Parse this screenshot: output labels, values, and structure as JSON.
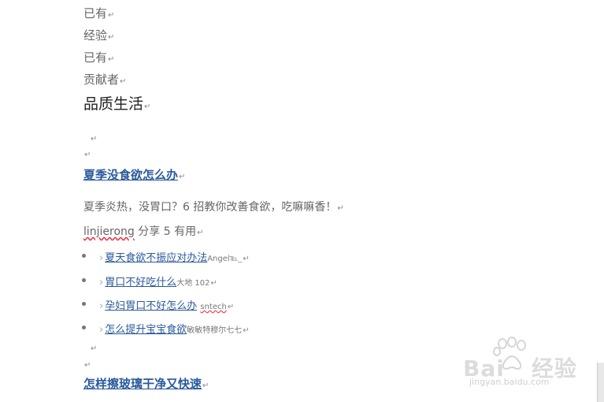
{
  "lines": {
    "l1": "已有",
    "l2": "经验",
    "l3": "已有",
    "l4": "贡献者",
    "section_title": "品质生活"
  },
  "pilcrow": "↵",
  "article1": {
    "title": "夏季没食欲怎么办",
    "desc": "夏季炎热，没胃口？6 招教你改善食欲，吃嘛嘛香！",
    "author": "linjierong",
    "share_text": " 分享 5 有用",
    "related": [
      {
        "title": "夏天食欲不振应对办法",
        "author": "Angel℡_"
      },
      {
        "title": "胃口不好吃什么",
        "author": "大地 102"
      },
      {
        "title": "孕妇胃口不好怎么办",
        "author": "sntech"
      },
      {
        "title": "怎么提升宝宝食欲",
        "author": "敏敏特穆尔七七"
      }
    ]
  },
  "article2": {
    "title": "怎样擦玻璃干净又快速"
  },
  "watermark": {
    "brand_left": "Bai",
    "brand_right": "经验",
    "url": "jingyan.baidu.com"
  }
}
